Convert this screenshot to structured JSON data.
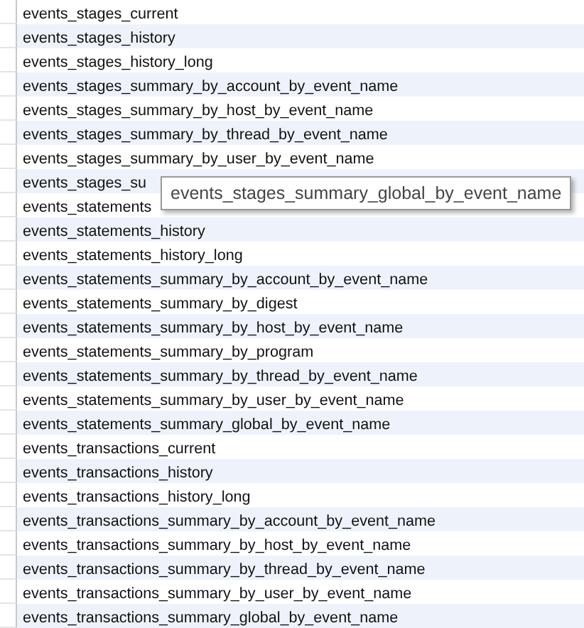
{
  "table": {
    "rows": [
      {
        "name": "events_stages_current"
      },
      {
        "name": "events_stages_history"
      },
      {
        "name": "events_stages_history_long"
      },
      {
        "name": "events_stages_summary_by_account_by_event_name"
      },
      {
        "name": "events_stages_summary_by_host_by_event_name"
      },
      {
        "name": "events_stages_summary_by_thread_by_event_name"
      },
      {
        "name": "events_stages_summary_by_user_by_event_name"
      },
      {
        "name": "events_stages_su"
      },
      {
        "name": "events_statements"
      },
      {
        "name": "events_statements_history"
      },
      {
        "name": "events_statements_history_long"
      },
      {
        "name": "events_statements_summary_by_account_by_event_name"
      },
      {
        "name": "events_statements_summary_by_digest"
      },
      {
        "name": "events_statements_summary_by_host_by_event_name"
      },
      {
        "name": "events_statements_summary_by_program"
      },
      {
        "name": "events_statements_summary_by_thread_by_event_name"
      },
      {
        "name": "events_statements_summary_by_user_by_event_name"
      },
      {
        "name": "events_statements_summary_global_by_event_name"
      },
      {
        "name": "events_transactions_current"
      },
      {
        "name": "events_transactions_history"
      },
      {
        "name": "events_transactions_history_long"
      },
      {
        "name": "events_transactions_summary_by_account_by_event_name"
      },
      {
        "name": "events_transactions_summary_by_host_by_event_name"
      },
      {
        "name": "events_transactions_summary_by_thread_by_event_name"
      },
      {
        "name": "events_transactions_summary_by_user_by_event_name"
      },
      {
        "name": "events_transactions_summary_global_by_event_name"
      }
    ]
  },
  "tooltip": {
    "text": "events_stages_summary_global_by_event_name"
  }
}
